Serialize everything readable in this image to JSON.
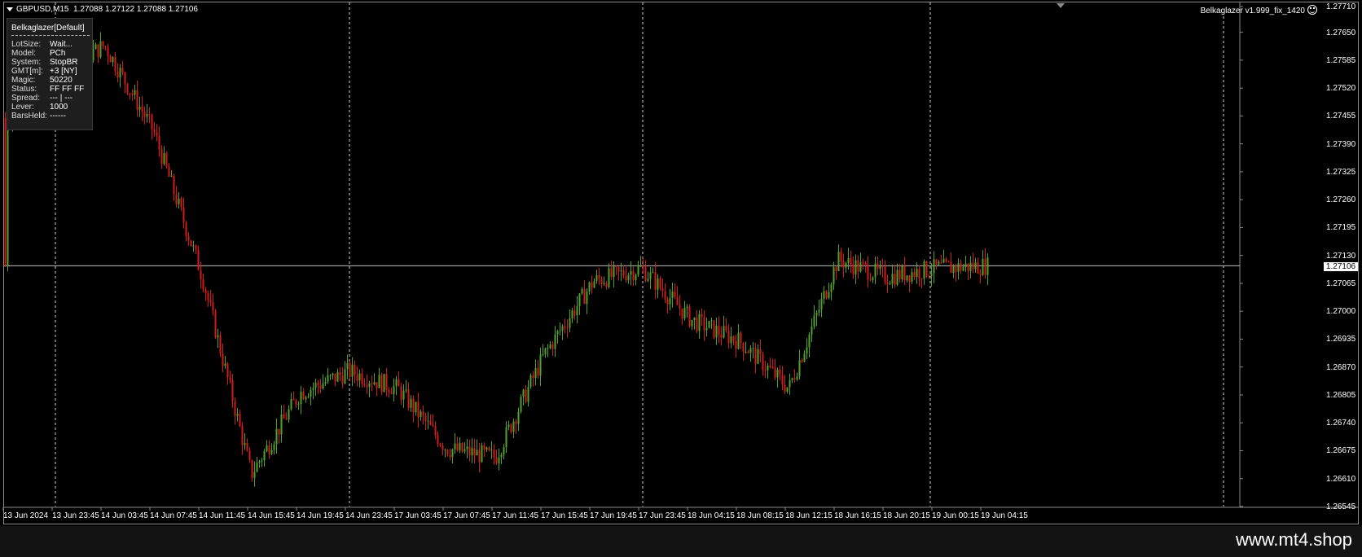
{
  "header": {
    "symbol": "GBPUSD,M15",
    "ohlc": "1.27088 1.27122 1.27088 1.27106",
    "ea_name": "Belkaglazer v1.999_fix_1420"
  },
  "info_panel": {
    "title": "Belkaglazer[Default]",
    "rows": [
      {
        "key": "LotSize:",
        "value": "Wait..."
      },
      {
        "key": "Model:",
        "value": "PCh"
      },
      {
        "key": "System:",
        "value": "StopBR"
      },
      {
        "key": "GMT[m]:",
        "value": "+3 [NY]"
      },
      {
        "key": "Magic:",
        "value": "50220"
      },
      {
        "key": "Status:",
        "value": "FF FF FF"
      },
      {
        "key": "Spread:",
        "value": "--- | ---"
      },
      {
        "key": "Lever:",
        "value": "1000"
      },
      {
        "key": "BarsHeld:",
        "value": "------"
      }
    ]
  },
  "price_axis": [
    "1.27710",
    "1.27650",
    "1.27585",
    "1.27520",
    "1.27455",
    "1.27390",
    "1.27325",
    "1.27260",
    "1.27195",
    "1.27130",
    "1.27065",
    "1.27000",
    "1.26935",
    "1.26870",
    "1.26805",
    "1.26740",
    "1.26675",
    "1.26610",
    "1.26545"
  ],
  "current_price": "1.27106",
  "time_axis": [
    "13 Jun 2024",
    "13 Jun 23:45",
    "14 Jun 03:45",
    "14 Jun 07:45",
    "14 Jun 11:45",
    "14 Jun 15:45",
    "14 Jun 19:45",
    "14 Jun 23:45",
    "17 Jun 03:45",
    "17 Jun 07:45",
    "17 Jun 11:45",
    "17 Jun 15:45",
    "17 Jun 19:45",
    "17 Jun 23:45",
    "18 Jun 04:15",
    "18 Jun 08:15",
    "18 Jun 12:15",
    "18 Jun 16:15",
    "18 Jun 20:15",
    "19 Jun 00:15",
    "19 Jun 04:15"
  ],
  "colors": {
    "bull": "#4fa22a",
    "bear": "#d41a1a",
    "background": "#000000",
    "grid": "#c8c8c8"
  },
  "brand": "www.mt4.shop",
  "chart_data": {
    "type": "candlestick",
    "symbol": "GBPUSD",
    "timeframe": "M15",
    "ylim": [
      1.26545,
      1.2771
    ],
    "period_separators": [
      "13 Jun 23:45",
      "14 Jun 23:45",
      "17 Jun 23:45",
      "19 Jun 00:15"
    ],
    "price_path": [
      {
        "t": "13 Jun 2024",
        "p": 1.2745
      },
      {
        "t": "13 Jun 23:45",
        "p": 1.2755
      },
      {
        "t": "14 Jun 03:45",
        "p": 1.2762
      },
      {
        "t": "14 Jun 07:45",
        "p": 1.2742
      },
      {
        "t": "14 Jun 11:45",
        "p": 1.2708
      },
      {
        "t": "14 Jun 15:45",
        "p": 1.2662
      },
      {
        "t": "14 Jun 19:45",
        "p": 1.2681
      },
      {
        "t": "14 Jun 23:45",
        "p": 1.2686
      },
      {
        "t": "17 Jun 03:45",
        "p": 1.2682
      },
      {
        "t": "17 Jun 07:45",
        "p": 1.2668
      },
      {
        "t": "17 Jun 11:45",
        "p": 1.2666
      },
      {
        "t": "17 Jun 15:45",
        "p": 1.269
      },
      {
        "t": "17 Jun 19:45",
        "p": 1.2707
      },
      {
        "t": "17 Jun 23:45",
        "p": 1.271
      },
      {
        "t": "18 Jun 04:15",
        "p": 1.2698
      },
      {
        "t": "18 Jun 08:15",
        "p": 1.2693
      },
      {
        "t": "18 Jun 12:15",
        "p": 1.2682
      },
      {
        "t": "18 Jun 16:15",
        "p": 1.2712
      },
      {
        "t": "18 Jun 20:15",
        "p": 1.2708
      },
      {
        "t": "19 Jun 00:15",
        "p": 1.271
      },
      {
        "t": "19 Jun 04:15",
        "p": 1.27106
      }
    ]
  }
}
